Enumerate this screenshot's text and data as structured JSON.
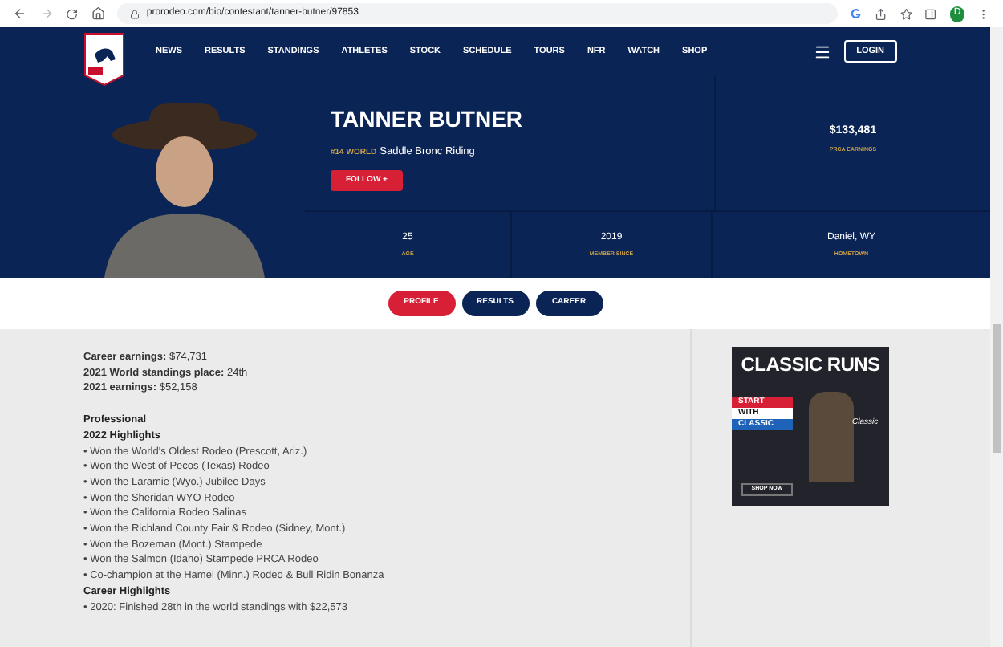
{
  "browser": {
    "url": "prorodeo.com/bio/contestant/tanner-butner/97853",
    "avatar": "D"
  },
  "nav": {
    "items": [
      "NEWS",
      "RESULTS",
      "STANDINGS",
      "ATHLETES",
      "STOCK",
      "SCHEDULE",
      "TOURS",
      "NFR",
      "WATCH",
      "SHOP"
    ],
    "login": "LOGIN"
  },
  "hero": {
    "name": "TANNER BUTNER",
    "rank": "#14 WORLD",
    "event": "Saddle Bronc Riding",
    "follow": "FOLLOW +",
    "earnings": {
      "value": "$133,481",
      "label": "PRCA EARNINGS"
    },
    "stats": [
      {
        "value": "25",
        "label": "AGE"
      },
      {
        "value": "2019",
        "label": "MEMBER SINCE"
      },
      {
        "value": "Daniel, WY",
        "label": "HOMETOWN"
      }
    ]
  },
  "tabs": [
    {
      "label": "PROFILE",
      "selected": true
    },
    {
      "label": "RESULTS",
      "selected": false
    },
    {
      "label": "CAREER",
      "selected": false
    }
  ],
  "bio": [
    {
      "kind": "fact",
      "text": "**Career earnings:** $74,731"
    },
    {
      "kind": "fact",
      "text": "**2021 World standings place:** 24th"
    },
    {
      "kind": "fact",
      "text": "**2021 earnings:** $52,158"
    },
    {
      "kind": "gap"
    },
    {
      "kind": "heading",
      "text": "Professional"
    },
    {
      "kind": "heading",
      "text": "2022 Highlights"
    },
    {
      "kind": "item",
      "text": "• Won the World's Oldest Rodeo (Prescott, Ariz.)"
    },
    {
      "kind": "item",
      "text": "• Won the West of Pecos (Texas) Rodeo"
    },
    {
      "kind": "item",
      "text": "• Won the Laramie (Wyo.) Jubilee Days"
    },
    {
      "kind": "item",
      "text": "• Won the Sheridan WYO Rodeo"
    },
    {
      "kind": "item",
      "text": "• Won the California Rodeo Salinas"
    },
    {
      "kind": "item",
      "text": "• Won the Richland County Fair & Rodeo (Sidney, Mont.)"
    },
    {
      "kind": "item",
      "text": "• Won the Bozeman (Mont.) Stampede"
    },
    {
      "kind": "item",
      "text": "• Won the Salmon (Idaho) Stampede PRCA Rodeo"
    },
    {
      "kind": "item",
      "text": "• Co-champion at the Hamel (Minn.) Rodeo & Bull Ridin Bonanza"
    },
    {
      "kind": "heading",
      "text": "Career Highlights"
    },
    {
      "kind": "item",
      "text": "• 2020: Finished 28th in the world standings with $22,573"
    }
  ],
  "ad": {
    "title": "CLASSIC RUNS",
    "stripes": [
      {
        "text": "START",
        "color": "#d71f35"
      },
      {
        "text": "WITH",
        "color": "#ffffff"
      },
      {
        "text": "CLASSIC",
        "color": "#1e63b8"
      }
    ],
    "brand": "Classic",
    "button": "SHOP NOW"
  }
}
